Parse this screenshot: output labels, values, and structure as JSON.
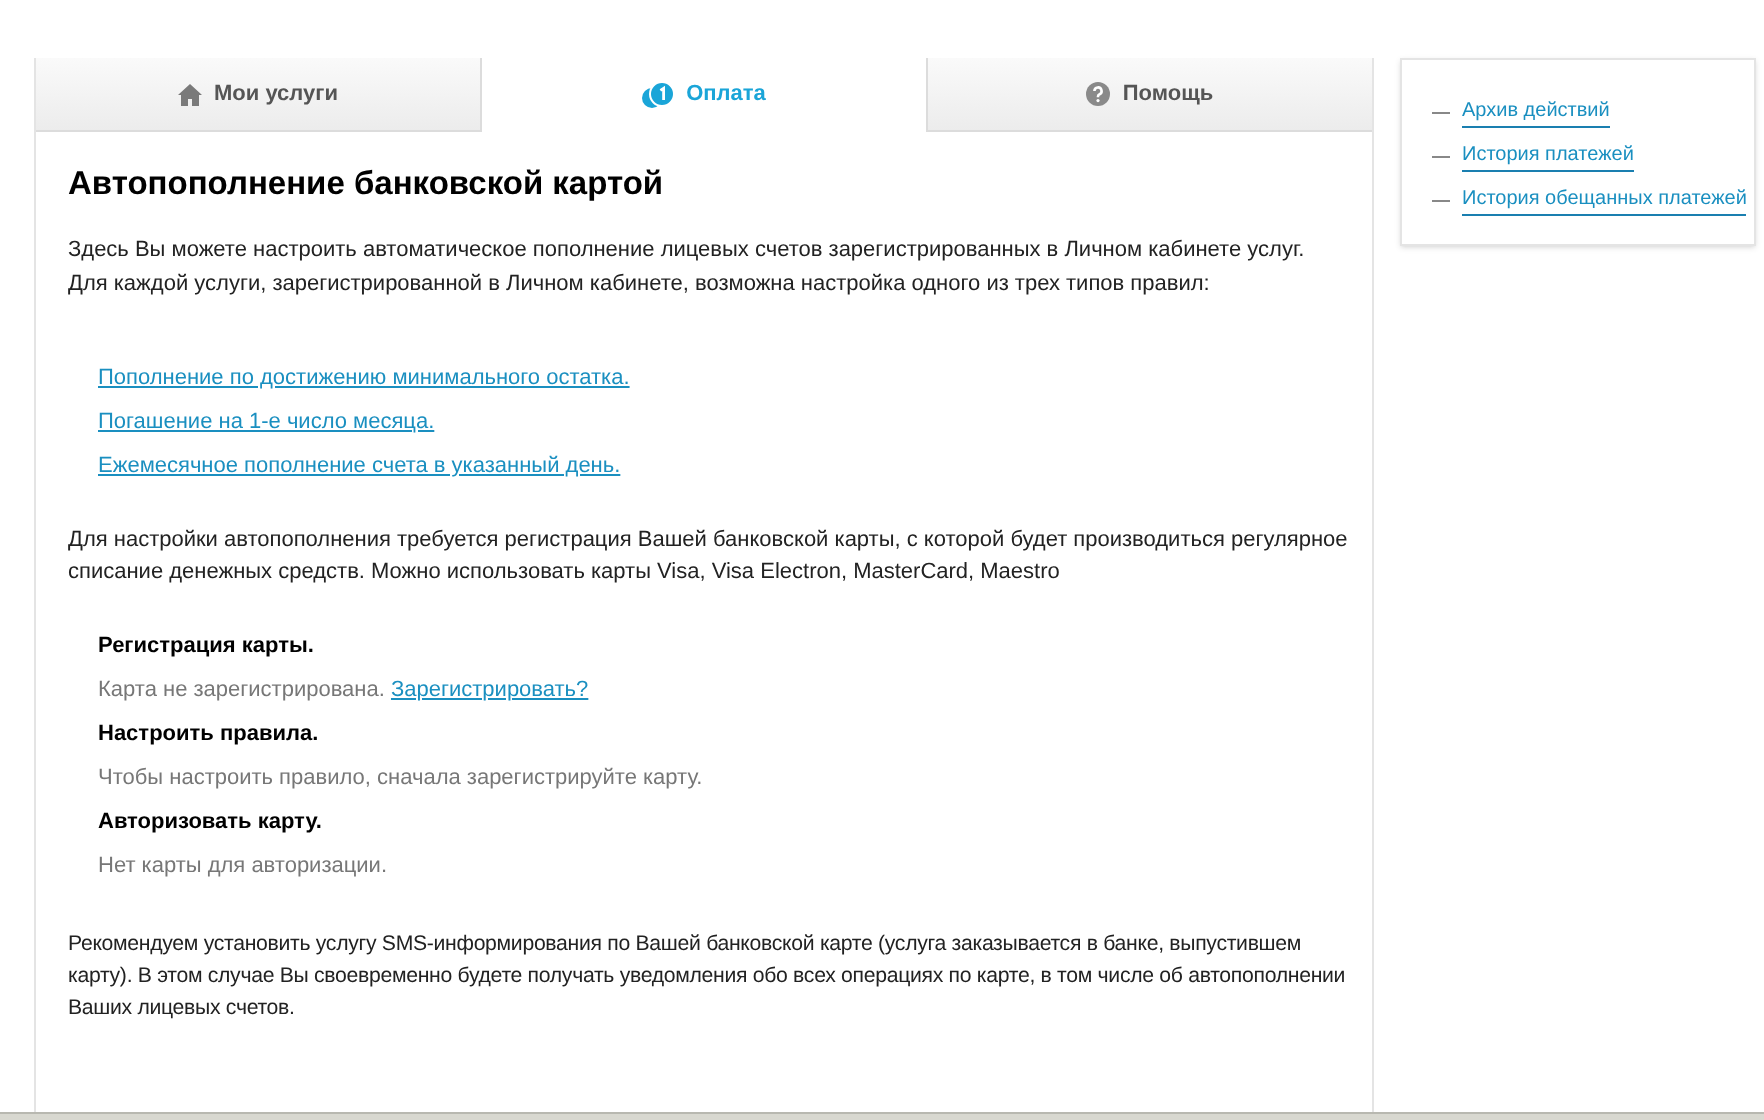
{
  "tabs": [
    {
      "label": "Мои услуги",
      "selected": false
    },
    {
      "label": "Оплата",
      "selected": true
    },
    {
      "label": "Помощь",
      "selected": false
    }
  ],
  "title": "Автопополнение банковской картой",
  "intro": [
    "Здесь Вы можете настроить автоматическое пополнение лицевых счетов зарегистрированных в Личном кабинете услуг.",
    "Для каждой услуги, зарегистрированной в Личном кабинете, возможна настройка одного из трех типов правил:"
  ],
  "rule_links": [
    "Пополнение по достижению минимального остатка.",
    "Погашение на 1-е число месяца.",
    "Ежемесячное пополнение счета в указанный день."
  ],
  "card_note": "Для настройки автопополнения требуется регистрация Вашей банковской карты, с которой будет производиться регулярное списание денежных средств. Можно использовать карты Visa, Visa Electron, MasterCard, Maestro",
  "steps": [
    {
      "heading": "Регистрация карты.",
      "text": "Карта не зарегистрирована.",
      "link": "Зарегистрировать?"
    },
    {
      "heading": "Настроить правила.",
      "text": "Чтобы настроить правило, сначала зарегистрируйте карту."
    },
    {
      "heading": "Авторизовать карту.",
      "text": "Нет карты для авторизации."
    }
  ],
  "sms_note": "Рекомендуем установить услугу SMS-информирования по Вашей банковской карте (услуга заказывается в банке, выпустившем карту). В этом случае Вы своевременно будете получать уведомления обо всех операциях по карте, в том числе об автопополнении Ваших лицевых счетов.",
  "sidebar": {
    "items": [
      {
        "label": "Архив действий"
      },
      {
        "label": "История платежей"
      },
      {
        "label": "История обещанных платежей"
      }
    ]
  }
}
